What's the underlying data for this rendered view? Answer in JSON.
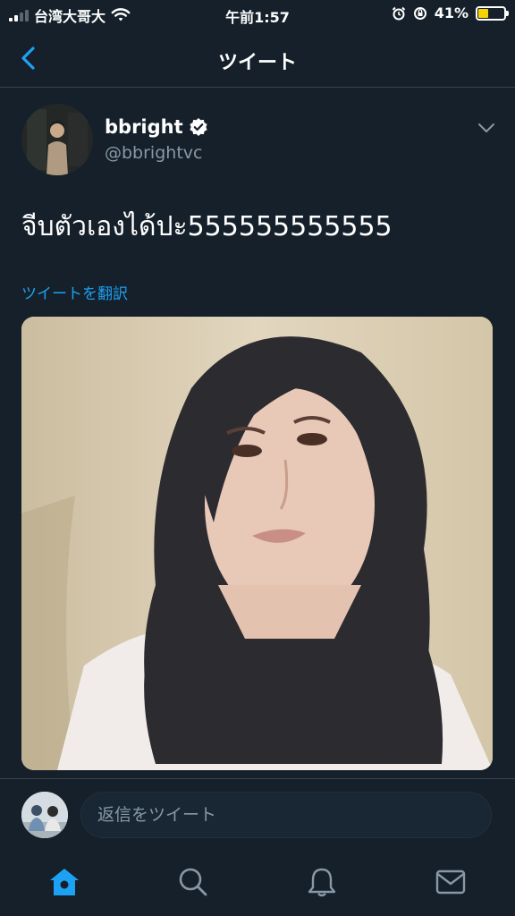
{
  "status_bar": {
    "carrier": "台湾大哥大",
    "time": "午前1:57",
    "battery_percent": "41%",
    "battery_level": 0.41
  },
  "header": {
    "title": "ツイート"
  },
  "tweet": {
    "display_name": "bbright",
    "handle": "@bbrightvc",
    "text": "จีบตัวเองได้ปะ555555555555",
    "translate_label": "ツイートを翻訳"
  },
  "reply": {
    "placeholder": "返信をツイート"
  },
  "tabs": [
    {
      "name": "home-icon"
    },
    {
      "name": "search-icon"
    },
    {
      "name": "bell-icon"
    },
    {
      "name": "mail-icon"
    }
  ],
  "colors": {
    "background": "#15202b",
    "accent": "#1da1f2",
    "secondary_text": "#8899a6",
    "battery": "#f5d200"
  }
}
